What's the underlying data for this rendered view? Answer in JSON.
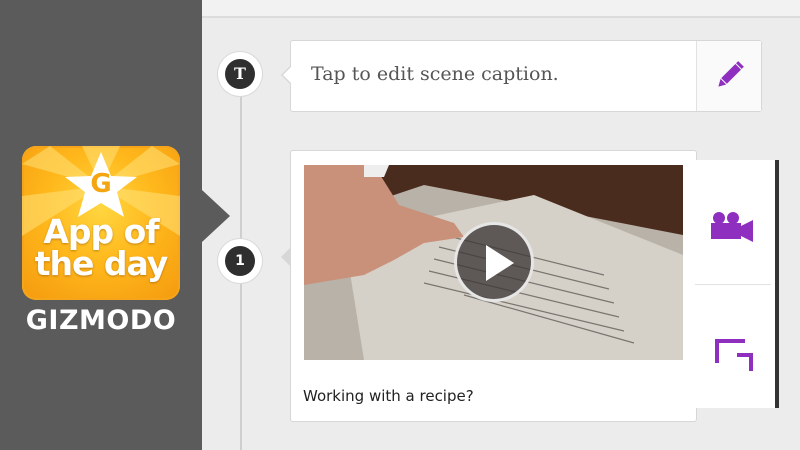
{
  "badge": {
    "letter": "G",
    "title_line1": "App of",
    "title_line2": "the day",
    "brand": "GIZMODO"
  },
  "timeline": {
    "caption_node_label": "T",
    "scene_node_label": "1",
    "caption_placeholder": "Tap to edit scene caption.",
    "scene_caption": "Working with a recipe?"
  },
  "icons": {
    "edit": "pencil-icon",
    "video": "video-camera-icon",
    "crop": "crop-icon",
    "play": "play-icon"
  },
  "colors": {
    "accent": "#8e2fc0",
    "sidebar": "#5b5b5b",
    "badge_orange": "#f7a81c"
  }
}
